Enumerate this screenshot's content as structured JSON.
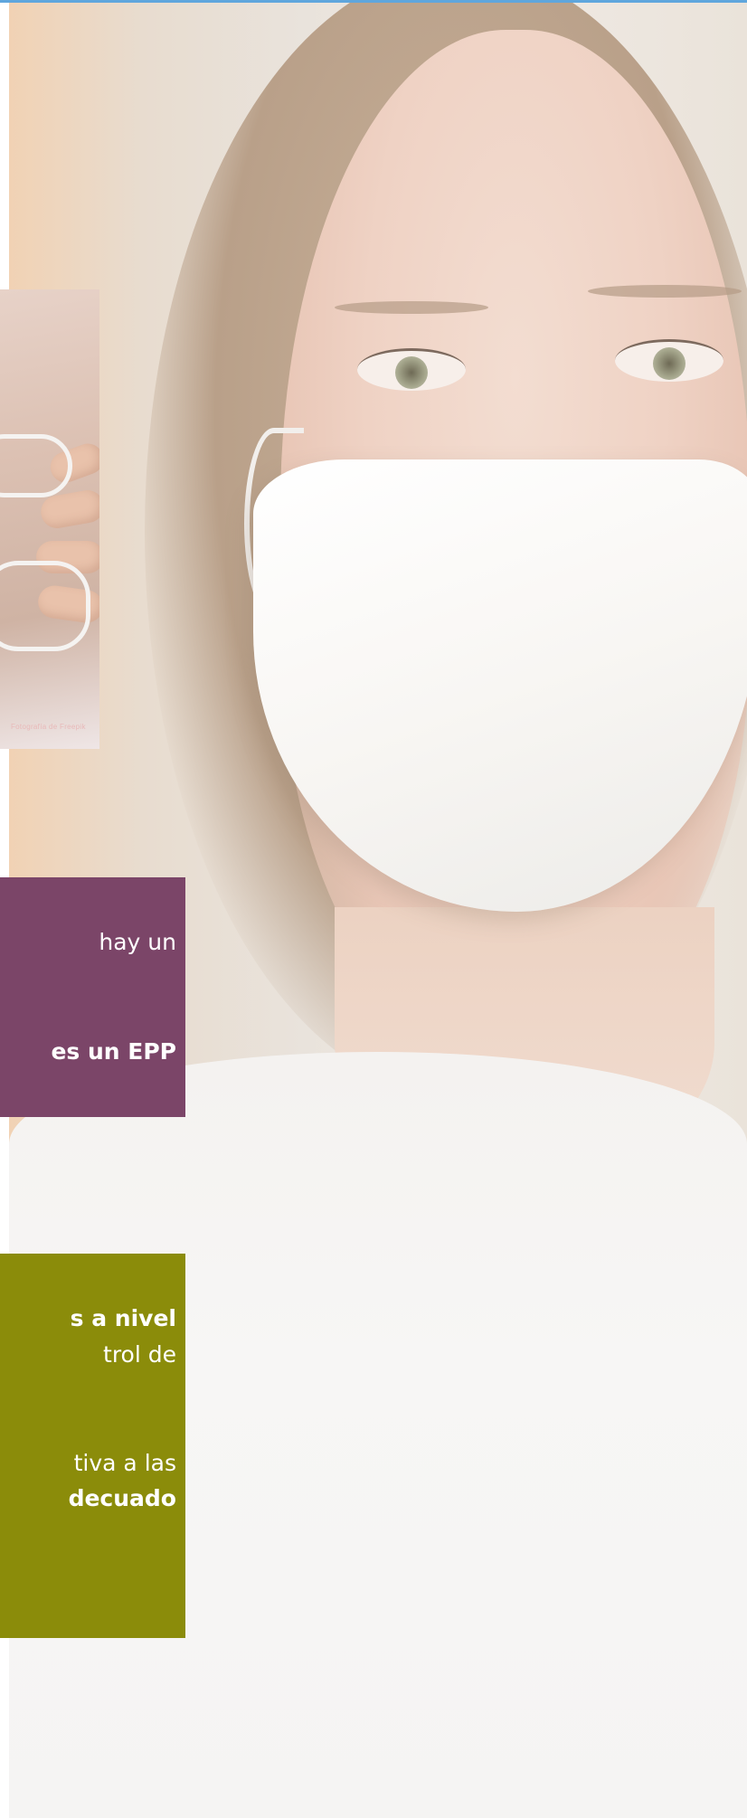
{
  "background": {
    "image": "woman-wearing-white-face-mask",
    "inset_image": "hands-holding-face-mask"
  },
  "inset": {
    "caption": "Fotografía de Freepik"
  },
  "purple_card": {
    "color": "#7b4568",
    "line1": "hay un",
    "line2": "es un EPP"
  },
  "olive_card": {
    "color": "#8b8c0a",
    "line1": "s a nivel",
    "line2": "trol de",
    "line3": "tiva a las",
    "line4": "decuado"
  }
}
